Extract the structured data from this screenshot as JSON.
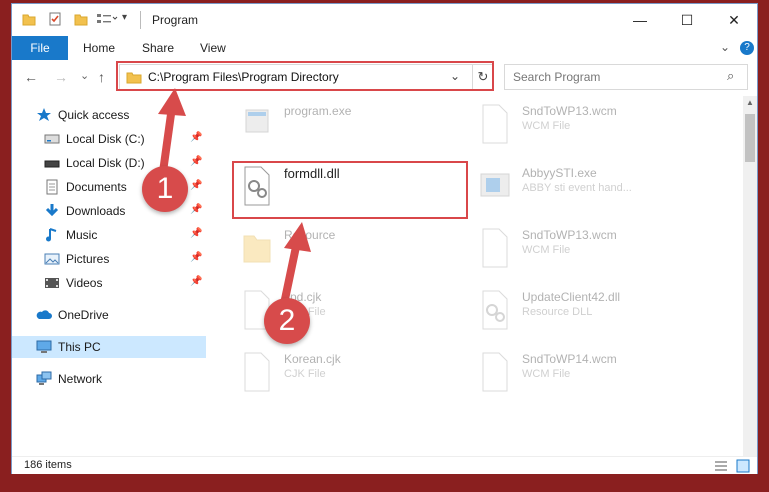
{
  "window": {
    "title": "Program",
    "caption": {
      "minimize": "—",
      "maximize": "☐",
      "close": "✕"
    }
  },
  "ribbon": {
    "tabs": [
      {
        "label": "File"
      },
      {
        "label": "Home"
      },
      {
        "label": "Share"
      },
      {
        "label": "View"
      }
    ],
    "collapse_glyph": "⌄",
    "help_glyph": "?"
  },
  "navbar": {
    "back": "←",
    "forward": "→",
    "recent": "⌄",
    "up": "↑",
    "address": "C:\\Program Files\\Program Directory",
    "address_dropdown": "⌄",
    "refresh": "↻",
    "search_placeholder": "Search Program",
    "search_glyph": "⌕"
  },
  "sidebar": {
    "quick_access": "Quick access",
    "items": [
      {
        "label": "Local Disk (C:)",
        "icon": "drive-icon"
      },
      {
        "label": "Local Disk (D:)",
        "icon": "drive-icon"
      },
      {
        "label": "Documents",
        "icon": "documents-icon"
      },
      {
        "label": "Downloads",
        "icon": "downloads-icon"
      },
      {
        "label": "Music",
        "icon": "music-icon"
      },
      {
        "label": "Pictures",
        "icon": "pictures-icon"
      },
      {
        "label": "Videos",
        "icon": "videos-icon"
      }
    ],
    "pin_glyph": "📌",
    "onedrive": "OneDrive",
    "this_pc": "This PC",
    "network": "Network"
  },
  "files": [
    {
      "name": "program.exe",
      "type": ""
    },
    {
      "name": "SndToWP13.wcm",
      "type": "WCM File"
    },
    {
      "name": "formdll.dll",
      "type": ""
    },
    {
      "name": "AbbyySTI.exe",
      "type": "ABBY sti event hand..."
    },
    {
      "name": "Resource",
      "type": ""
    },
    {
      "name": "SndToWP13.wcm",
      "type": "WCM File"
    },
    {
      "name": "Jpd.cjk",
      "type": "CJK File"
    },
    {
      "name": "UpdateClient42.dll",
      "type": "Resource DLL"
    },
    {
      "name": "Korean.cjk",
      "type": "CJK File"
    },
    {
      "name": "SndToWP14.wcm",
      "type": "WCM File"
    }
  ],
  "annotations": {
    "step1": "1",
    "step2": "2"
  },
  "status": {
    "items_count": "186 items"
  },
  "colors": {
    "accent": "#1979ca",
    "highlight": "#d9474a",
    "badge": "#d74b4b",
    "selected": "#cce8ff"
  }
}
